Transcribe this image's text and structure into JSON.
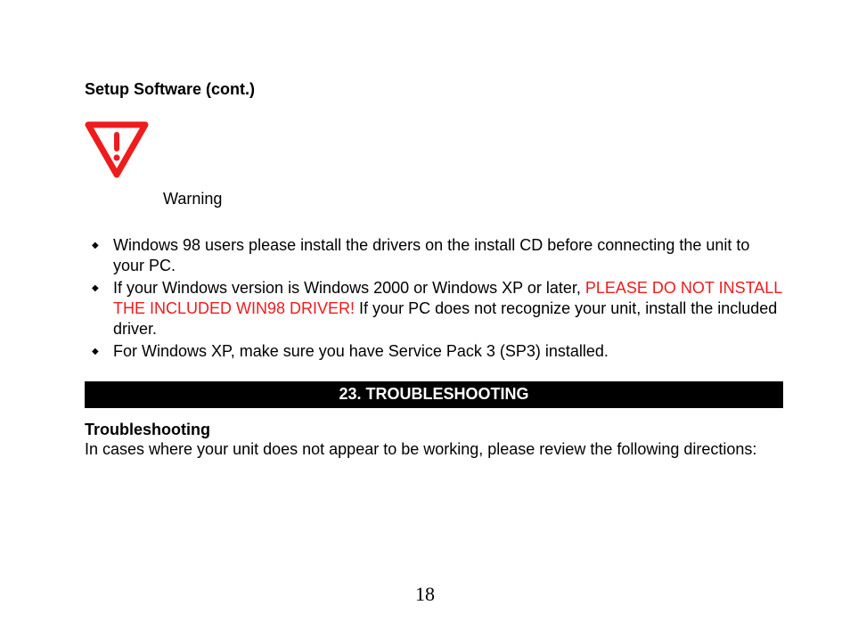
{
  "heading": "Setup Software (cont.)",
  "warning": {
    "label": "Warning"
  },
  "bullets": [
    {
      "text": "Windows 98 users please install the drivers on the install CD before connecting the unit to your PC."
    },
    {
      "pre": " If your Windows version is Windows 2000 or Windows XP or later, ",
      "red": "PLEASE DO NOT INSTALL THE INCLUDED WIN98 DRIVER!",
      "post": "  If your PC does not recognize your unit, install the included driver."
    },
    {
      "text": "For Windows XP, make sure you have Service Pack 3 (SP3) installed."
    }
  ],
  "section_bar": "23.  TROUBLESHOOTING",
  "troubleshoot": {
    "heading": "Troubleshooting",
    "body": "In cases where your unit does not appear to be working, please review the following directions:"
  },
  "page_number": "18"
}
